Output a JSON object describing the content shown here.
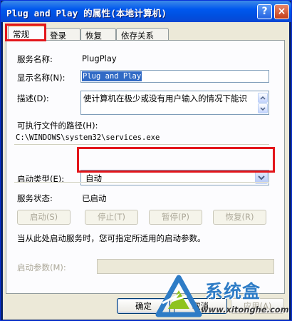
{
  "window": {
    "title": "Plug and Play 的属性(本地计算机)",
    "help_glyph": "?",
    "close_glyph": "×"
  },
  "tabs": [
    {
      "label": "常规",
      "active": true
    },
    {
      "label": "登录",
      "active": false
    },
    {
      "label": "恢复",
      "active": false
    },
    {
      "label": "依存关系",
      "active": false
    }
  ],
  "general": {
    "service_name_label": "服务名称:",
    "service_name_value": "PlugPlay",
    "display_name_label": "显示名称(N):",
    "display_name_value": "Plug and Play",
    "description_label": "描述(D):",
    "description_value": "使计算机在极少或没有用户输入的情况下能识",
    "exe_path_label": "可执行文件的路径(H):",
    "exe_path_value": "C:\\WINDOWS\\system32\\services.exe",
    "startup_type_label": "启动类型(E):",
    "startup_type_value": "自动",
    "service_status_label": "服务状态:",
    "service_status_value": "已启动",
    "buttons": {
      "start": "启动(S)",
      "stop": "停止(T)",
      "pause": "暂停(P)",
      "resume": "恢复(R)"
    },
    "hint": "当从此处启动服务时，您可指定所适用的启动参数。",
    "start_params_label": "启动参数(M):",
    "start_params_value": ""
  },
  "dialog_buttons": {
    "ok": "确定",
    "cancel": "取消",
    "apply": "应用(A)"
  },
  "watermark": {
    "name": "系统盒",
    "url": "www.xitonghe.com"
  },
  "colors": {
    "titlebar": "#0058ee",
    "highlight_box": "#e3161b",
    "active_tab_accent": "#e68b2c",
    "selection": "#316ac5",
    "watermark_blue": "#2e7cc6"
  },
  "icons": {
    "help": "help-icon",
    "close": "close-icon",
    "spin_up": "chevron-up-icon",
    "spin_down": "chevron-down-icon",
    "combo_arrow": "chevron-down-icon",
    "logo": "xitonghe-logo-icon"
  }
}
